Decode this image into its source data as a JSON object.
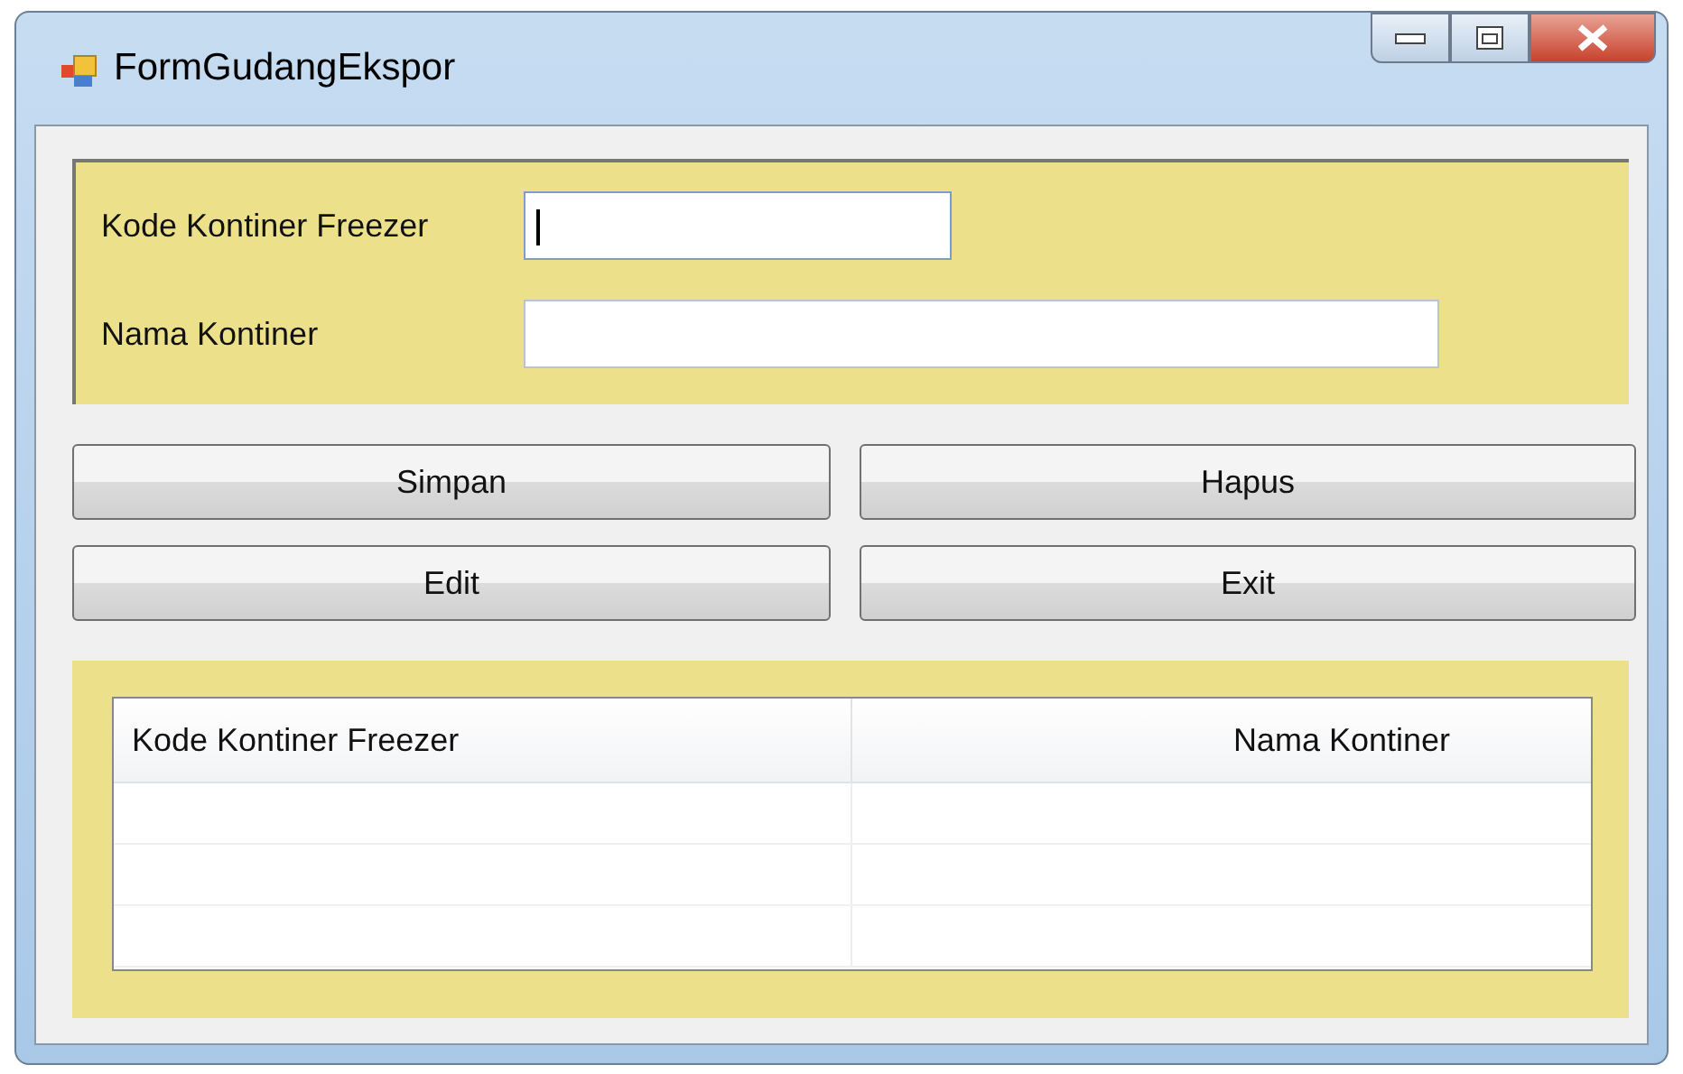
{
  "window": {
    "title": "FormGudangEkspor"
  },
  "fields": [
    {
      "label": "Kode Kontiner Freezer",
      "focused": true
    },
    {
      "label": "Nama Kontiner",
      "focused": false
    }
  ],
  "buttons": [
    "Simpan",
    "Hapus",
    "Edit",
    "Exit"
  ],
  "table": {
    "columns": [
      "Kode Kontiner Freezer",
      "Nama Kontiner"
    ]
  }
}
